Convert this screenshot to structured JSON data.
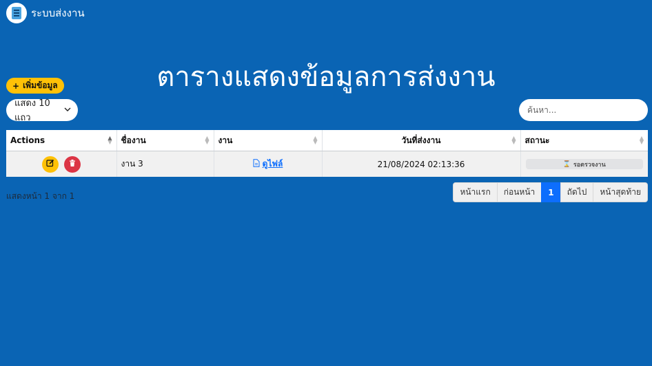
{
  "header": {
    "brand_title": "ระบบส่งงาน"
  },
  "page": {
    "title": "ตารางแสดงข้อมูลการส่งงาน"
  },
  "toolbar": {
    "add_label": "เพิ่มข้อมูล",
    "length_label": "แสดง 10 แถว",
    "search_placeholder": "ค้นหา..."
  },
  "table": {
    "columns": [
      "Actions",
      "ชื่องาน",
      "งาน",
      "วันที่ส่งงาน",
      "สถานะ"
    ],
    "rows": [
      {
        "name": "งาน 3",
        "file_label": "ดูไฟล์",
        "submitted_at": "21/08/2024 02:13:36",
        "status": "รอตรวจงาน"
      }
    ]
  },
  "footer": {
    "info": "แสดงหน้า 1 จาก 1",
    "pagination": {
      "first": "หน้าแรก",
      "prev": "ก่อนหน้า",
      "current": "1",
      "next": "ถัดไป",
      "last": "หน้าสุดท้าย"
    }
  },
  "colors": {
    "background": "#0a64b4",
    "warning": "#ffc107",
    "danger": "#dc3545",
    "primary": "#0d6efd"
  },
  "icons": {
    "brand": "document-list-icon",
    "add": "plus-icon",
    "edit": "pencil-square-icon",
    "delete": "trash-icon",
    "file": "file-icon",
    "status": "hourglass-icon",
    "dropdown": "chevron-down-icon"
  }
}
